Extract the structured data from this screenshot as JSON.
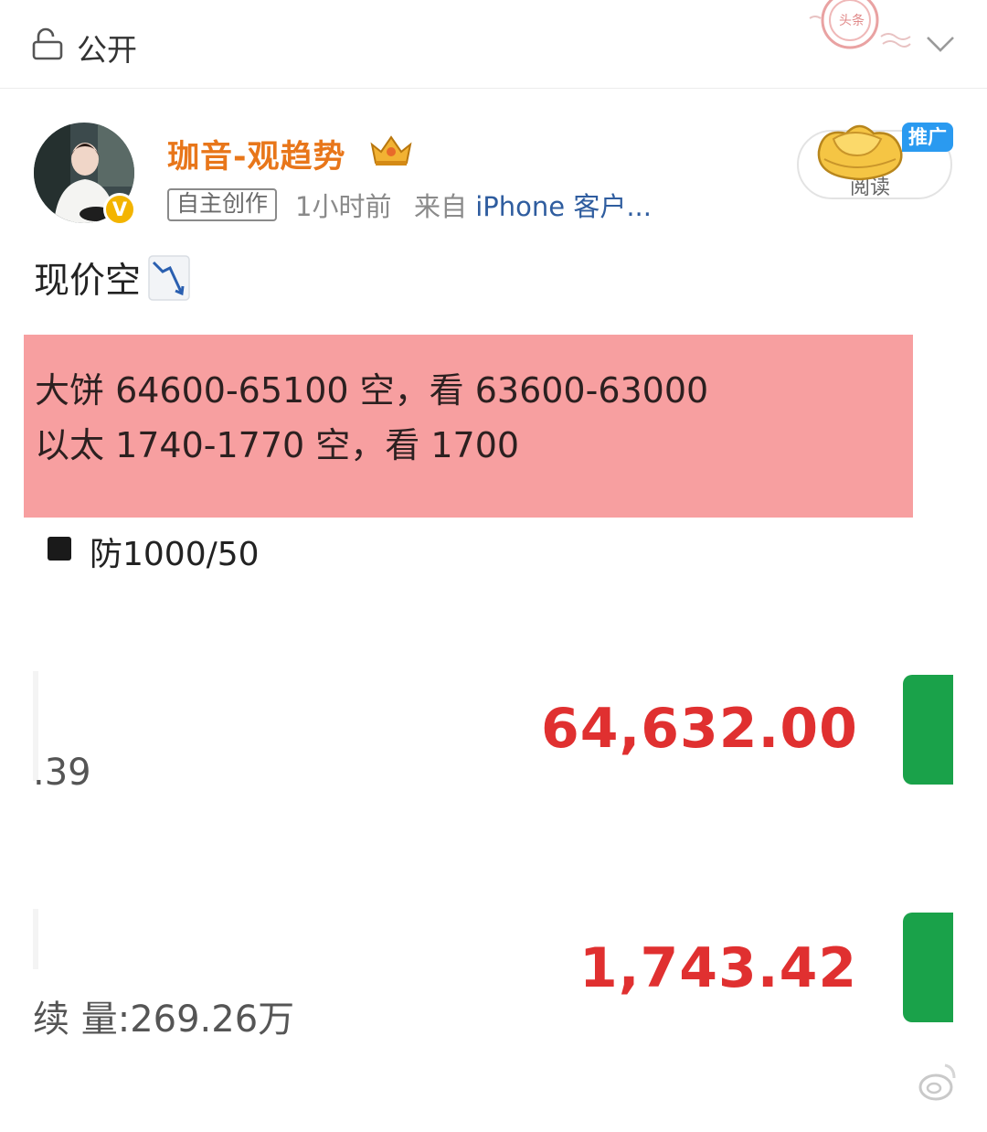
{
  "header": {
    "visibility_label": "公开",
    "stamp_text": "头条"
  },
  "author": {
    "name": "珈音-观趋势",
    "badge_letter": "V",
    "tag": "自主创作",
    "time": "1小时前",
    "source_prefix": "来自",
    "source_device": "iPhone 客户..."
  },
  "follow": {
    "label": "阅读",
    "promo_badge": "推广"
  },
  "post": {
    "title": "现价空",
    "lines": [
      "大饼 64600-65100 空，看 63600-63000",
      "以太 1740-1770 空，看 1700"
    ],
    "stop_loss": "防1000/50"
  },
  "screenshot": {
    "btc_price": "64,632.00",
    "btc_side": ".39",
    "eth_price": "1,743.42",
    "eth_side": "续 量:269.26万"
  },
  "icons": {
    "lock": "lock-icon",
    "chevron": "chevron-down-icon",
    "crown": "crown-icon",
    "gold": "gold-ingot-icon",
    "chart_down": "chart-decreasing-icon",
    "watermark": "weibo-icon"
  },
  "colors": {
    "username": "#e8761a",
    "highlight": "#f79fa0",
    "price_red": "#e03030",
    "green": "#1aa24a",
    "link": "#2f5d9f",
    "promo": "#2a9af0"
  }
}
